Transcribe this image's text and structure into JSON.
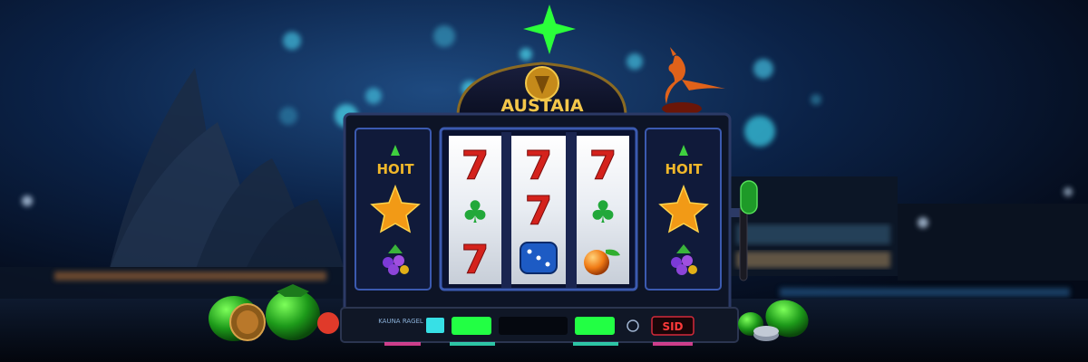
{
  "scene": {
    "sign_text": "AUSTAIA",
    "side_label_left": "HOIT",
    "side_label_right": "HOIT",
    "panel_small_text": "KAUNA\nRAGEL",
    "panel_red_text": "SID"
  },
  "reels": [
    [
      "seven",
      "shamrock",
      "seven"
    ],
    [
      "seven",
      "seven",
      "dice"
    ],
    [
      "seven",
      "shamrock",
      "orange"
    ]
  ],
  "colors": {
    "sky_top": "#071428",
    "sky_glow": "#1b3d6e",
    "bokeh": "#39c6e0",
    "star_green": "#2bff3a",
    "seven_red": "#d4221c",
    "gold": "#e3a321",
    "panel_green": "#22ff44",
    "machine_dark": "#0d1426"
  }
}
